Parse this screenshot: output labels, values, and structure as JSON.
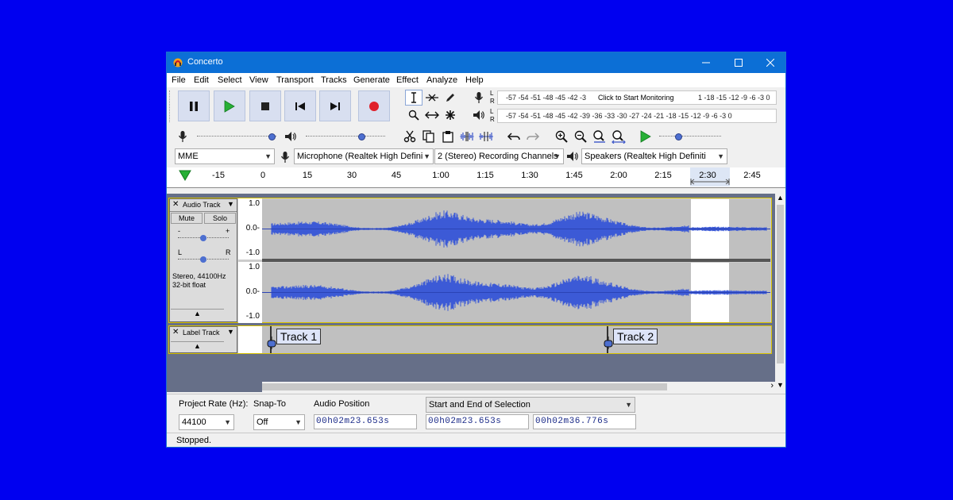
{
  "window": {
    "title": "Concerto",
    "accent": "#0c6fd6",
    "background": "#0000f0"
  },
  "menu": [
    {
      "label": "File",
      "key": "F"
    },
    {
      "label": "Edit",
      "key": "E"
    },
    {
      "label": "Select",
      "key": "S"
    },
    {
      "label": "View",
      "key": "V"
    },
    {
      "label": "Transport",
      "key": "T"
    },
    {
      "label": "Tracks",
      "key": "T"
    },
    {
      "label": "Generate",
      "key": "G"
    },
    {
      "label": "Effect",
      "key": "c"
    },
    {
      "label": "Analyze",
      "key": "A"
    },
    {
      "label": "Help",
      "key": "H"
    }
  ],
  "meters": {
    "record_scale": "-57 -54 -51 -48 -45 -42 -3",
    "record_prompt": "Click to Start Monitoring",
    "record_scale_tail": "1 -18 -15 -12  -9  -6  -3  0",
    "play_scale": "-57 -54 -51 -48 -45 -42 -39 -36 -33 -30 -27 -24 -21 -18 -15 -12  -9  -6  -3  0",
    "lr": [
      "L",
      "R"
    ]
  },
  "devices": {
    "host": "MME",
    "input": "Microphone (Realtek High Defini",
    "channels": "2 (Stereo) Recording Channels",
    "output": "Speakers (Realtek High Definiti"
  },
  "ruler": {
    "labels": [
      "-15",
      "0",
      "15",
      "30",
      "45",
      "1:00",
      "1:15",
      "1:30",
      "1:45",
      "2:00",
      "2:15",
      "2:30",
      "2:45"
    ]
  },
  "audio_track": {
    "name": "Audio Track",
    "mute": "Mute",
    "solo": "Solo",
    "gain_minus": "-",
    "gain_plus": "+",
    "pan_left": "L",
    "pan_right": "R",
    "info_line1": "Stereo, 44100Hz",
    "info_line2": "32-bit float",
    "scale": [
      "1.0",
      "0.0-",
      "-1.0"
    ]
  },
  "label_track": {
    "name": "Label Track",
    "labels": [
      "Track 1",
      "Track 2"
    ]
  },
  "selection_toolbar": {
    "rate_label": "Project Rate (Hz):",
    "rate_value": "44100",
    "snap_label": "Snap-To",
    "snap_value": "Off",
    "pos_label": "Audio Position",
    "pos_value": "00h02m23.653s",
    "sel_mode": "Start and End of Selection",
    "sel_start": "00h02m23.653s",
    "sel_end": "00h02m36.776s"
  },
  "status": "Stopped."
}
